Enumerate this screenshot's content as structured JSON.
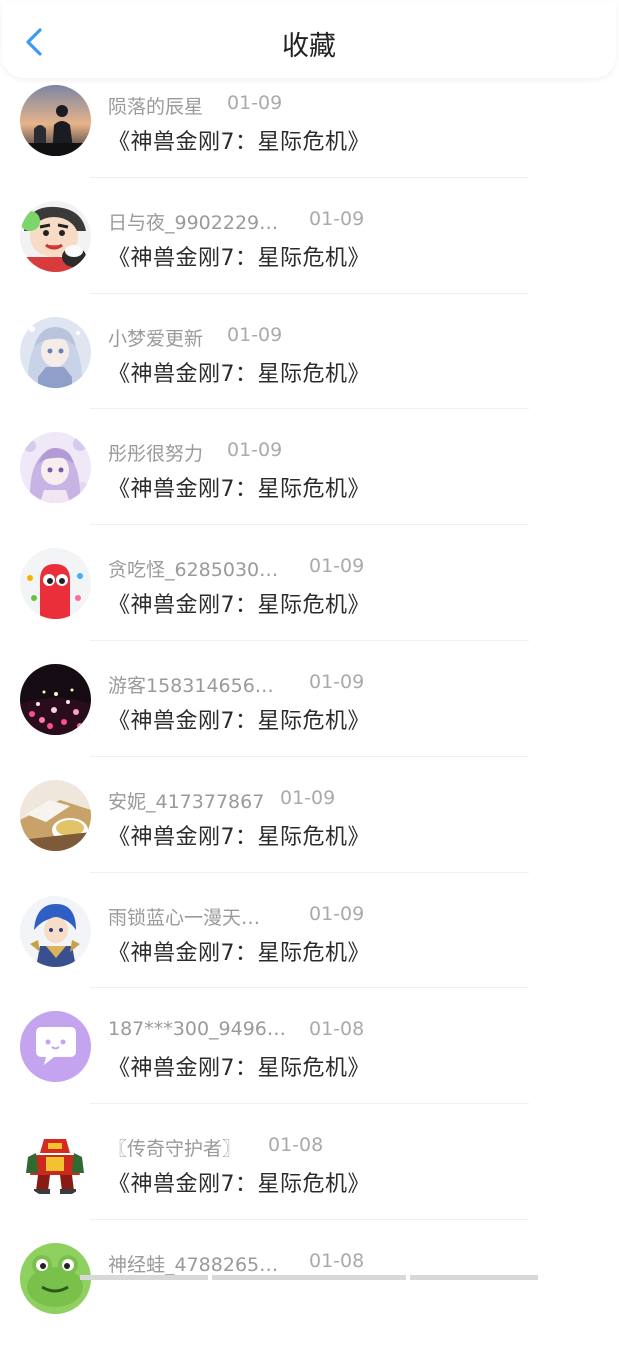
{
  "header": {
    "title": "收藏",
    "back_icon": "chevron-left-icon",
    "accent_color": "#3a9bf0"
  },
  "items": [
    {
      "username": "陨落的辰星",
      "date": "01-09",
      "movie": "《神兽金刚7：星际危机》",
      "avatar": "silhouette-sunset"
    },
    {
      "username": "日与夜_9902229…",
      "date": "01-09",
      "movie": "《神兽金刚7：星际危机》",
      "avatar": "cartoon-boy"
    },
    {
      "username": "小梦爱更新",
      "date": "01-09",
      "movie": "《神兽金刚7：星际危机》",
      "avatar": "anime-girl-blue"
    },
    {
      "username": "彤彤很努力",
      "date": "01-09",
      "movie": "《神兽金刚7：星际危机》",
      "avatar": "anime-girl-purple"
    },
    {
      "username": "贪吃怪_6285030…",
      "date": "01-09",
      "movie": "《神兽金刚7：星际危机》",
      "avatar": "red-monster"
    },
    {
      "username": "游客158314656…",
      "date": "01-09",
      "movie": "《神兽金刚7：星际危机》",
      "avatar": "heart-lights"
    },
    {
      "username": "安妮_417377867",
      "date": "01-09",
      "movie": "《神兽金刚7：星际危机》",
      "avatar": "tea-cake"
    },
    {
      "username": "雨锁蓝心一漫天…",
      "date": "01-09",
      "movie": "《神兽金刚7：星际危机》",
      "avatar": "anime-blue-hair"
    },
    {
      "username": "187***300_9496…",
      "date": "01-08",
      "movie": "《神兽金刚7：星际危机》",
      "avatar": "chat-bubble-purple"
    },
    {
      "username": "〖传奇守护者〗",
      "date": "01-08",
      "movie": "《神兽金刚7：星际危机》",
      "avatar": "robot-red"
    },
    {
      "username": "神经蛙_4788265…",
      "date": "01-08",
      "movie": "",
      "avatar": "green-frog"
    }
  ]
}
